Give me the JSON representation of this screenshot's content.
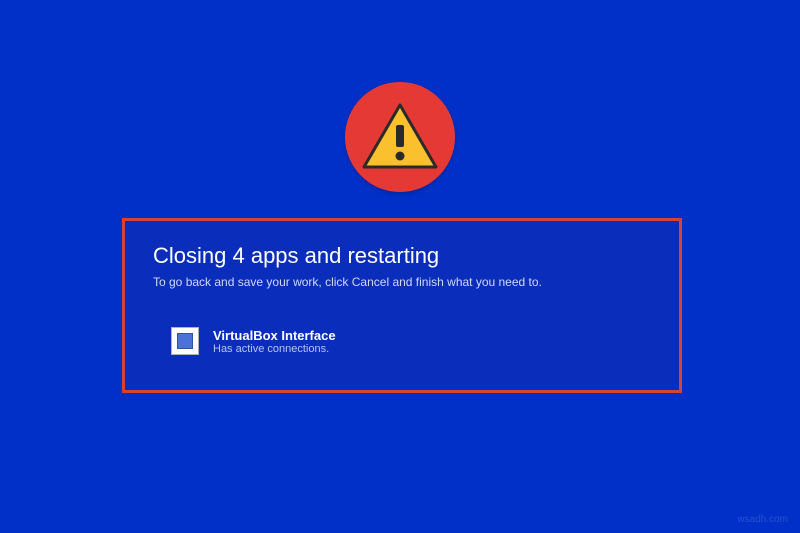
{
  "colors": {
    "background": "#0030c7",
    "dialog_bg": "#0b2dbb",
    "border": "#d64332",
    "badge_bg": "#e53935",
    "triangle_fill": "#fbc02d",
    "triangle_stroke": "#333333"
  },
  "dialog": {
    "title": "Closing 4 apps and restarting",
    "subtitle": "To go back and save your work, click Cancel and finish what you need to."
  },
  "app": {
    "name": "VirtualBox Interface",
    "status": "Has active connections."
  },
  "watermark": "wsadh.com"
}
